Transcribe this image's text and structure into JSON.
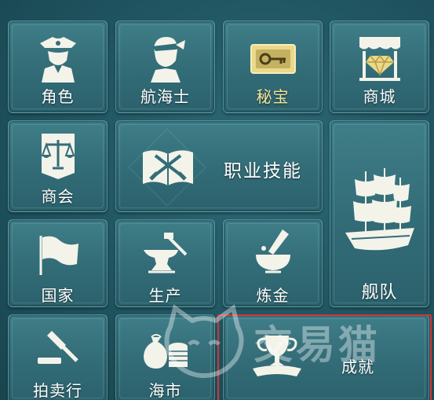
{
  "menu": {
    "role": "角色",
    "navigator": "航海士",
    "treasure": "秘宝",
    "mall": "商城",
    "guild": "商会",
    "career_skills": "职业技能",
    "fleet": "舰队",
    "nation": "国家",
    "production": "生产",
    "alchemy": "炼金",
    "auction": "拍卖行",
    "sea_market": "海市",
    "achievement": "成就"
  },
  "watermark": {
    "text": "交易猫"
  },
  "colors": {
    "tile_bg": "#336d78",
    "label_text": "#ffffff",
    "treasure_label": "#f4e39a",
    "highlight_border": "#d23636"
  }
}
